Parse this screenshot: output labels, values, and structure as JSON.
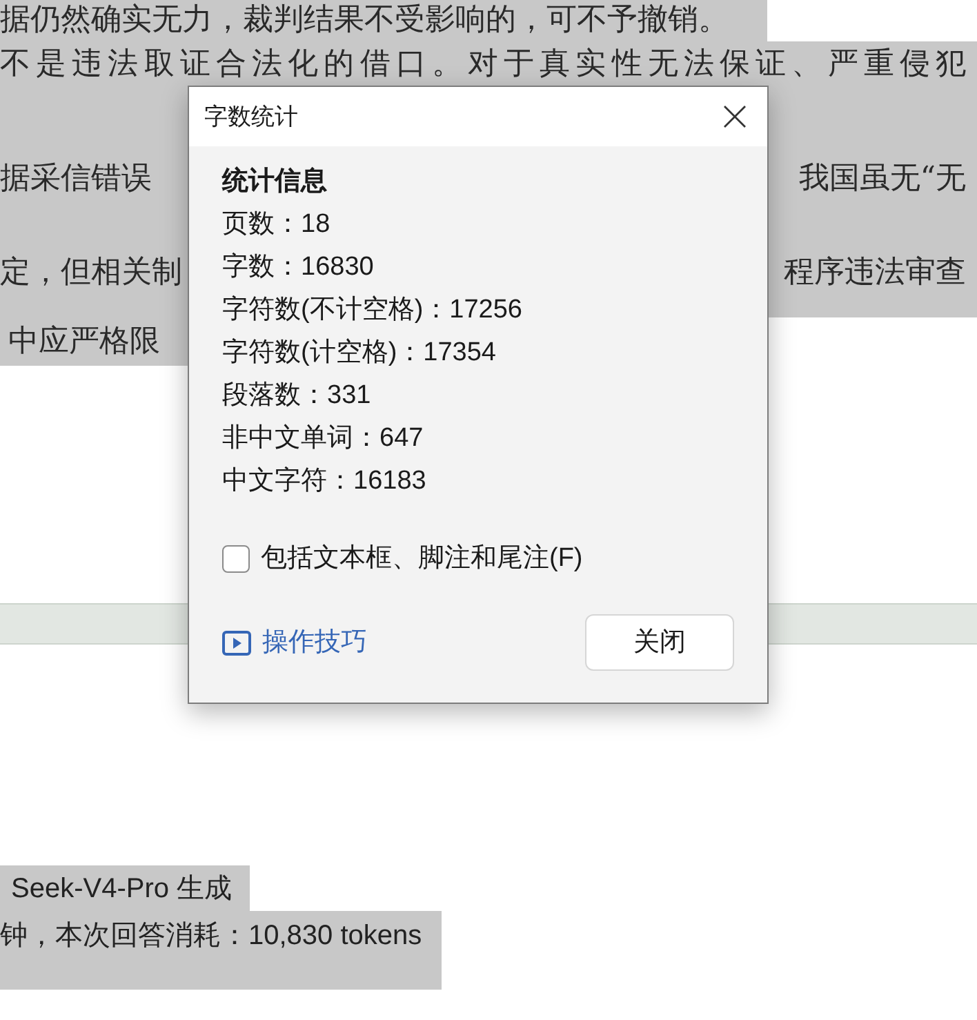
{
  "document": {
    "paragraphs": [
      {
        "selected": true,
        "lines": [
          [
            "据仍然确实无力，裁判结果不受影响的，可不予撤销。"
          ]
        ]
      },
      {
        "selected": true,
        "lines": [
          [
            "不是违法取证合法化的借口。对于真实性无法保证、严重侵犯"
          ],
          [
            "据采信错误",
            "我国虽无“无"
          ],
          [
            "定，但相关制",
            "程序违法审查"
          ],
          [
            "中应严格限"
          ]
        ]
      }
    ]
  },
  "note_lines": [
    {
      "selected": true,
      "text": "Seek-V4-Pro 生成"
    },
    {
      "selected": true,
      "text": "钟，本次回答消耗：10,830 tokens"
    }
  ],
  "dialog": {
    "title": "字数统计",
    "section_title": "统计信息",
    "stats": [
      "页数：18",
      "字数：16830",
      "字符数(不计空格)：17256",
      "字符数(计空格)：17354",
      "段落数：331",
      "非中文单词：647",
      "中文字符：16183"
    ],
    "checkbox": {
      "label": "包括文本框、脚注和尾注(F)",
      "checked": false
    },
    "link": "操作技巧",
    "button": "关闭"
  }
}
